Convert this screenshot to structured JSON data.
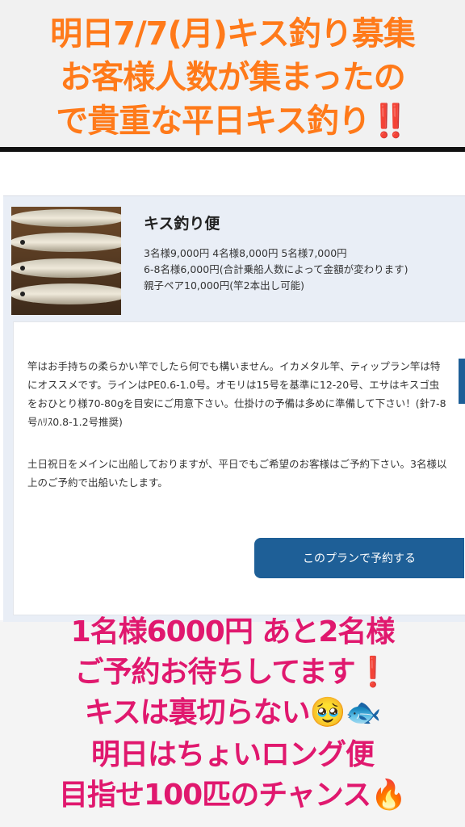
{
  "top_banner": {
    "line1": "明日7/7(月)キス釣り募集",
    "line2": "お客様人数が集まったの",
    "line3": "で貴重な平日キス釣り‼️"
  },
  "plan": {
    "title": "キス釣り便",
    "price_lines": [
      "3名様9,000円 4名様8,000円 5名様7,000円",
      "6-8名様6,000円(合計乗船人数によって金額が変わります)",
      "親子ペア10,000円(竿2本出し可能)"
    ],
    "description_1": "竿はお手持ちの柔らかい竿でしたら何でも構いません。イカメタル竿、ティップラン竿は特にオススメです。ラインはPE0.6-1.0号。オモリは15号を基準に12-20号、エサはキスゴ虫をおひとり様70-80gを目安にご用意下さい。仕掛けの予備は多めに準備して下さい！(針7-8号ﾊﾘｽ0.8-1.2号推奨)",
    "description_2": "土日祝日をメインに出船しておりますが、平日でもご希望のお客様はご予約下さい。3名様以上のご予約で出船いたします。",
    "reserve_button": "このプランで予約する"
  },
  "bottom_text": {
    "line1": "1名様6000円 あと2名様",
    "line2": "ご予約お待ちしてます❗️",
    "line3": "キスは裏切らない🥹🐟",
    "line4": "明日はちょいロング便",
    "line5": "目指せ100匹のチャンス🔥"
  },
  "colors": {
    "top_text": "#ff7a1a",
    "bottom_text": "#e0186e",
    "button": "#1e5f97"
  }
}
